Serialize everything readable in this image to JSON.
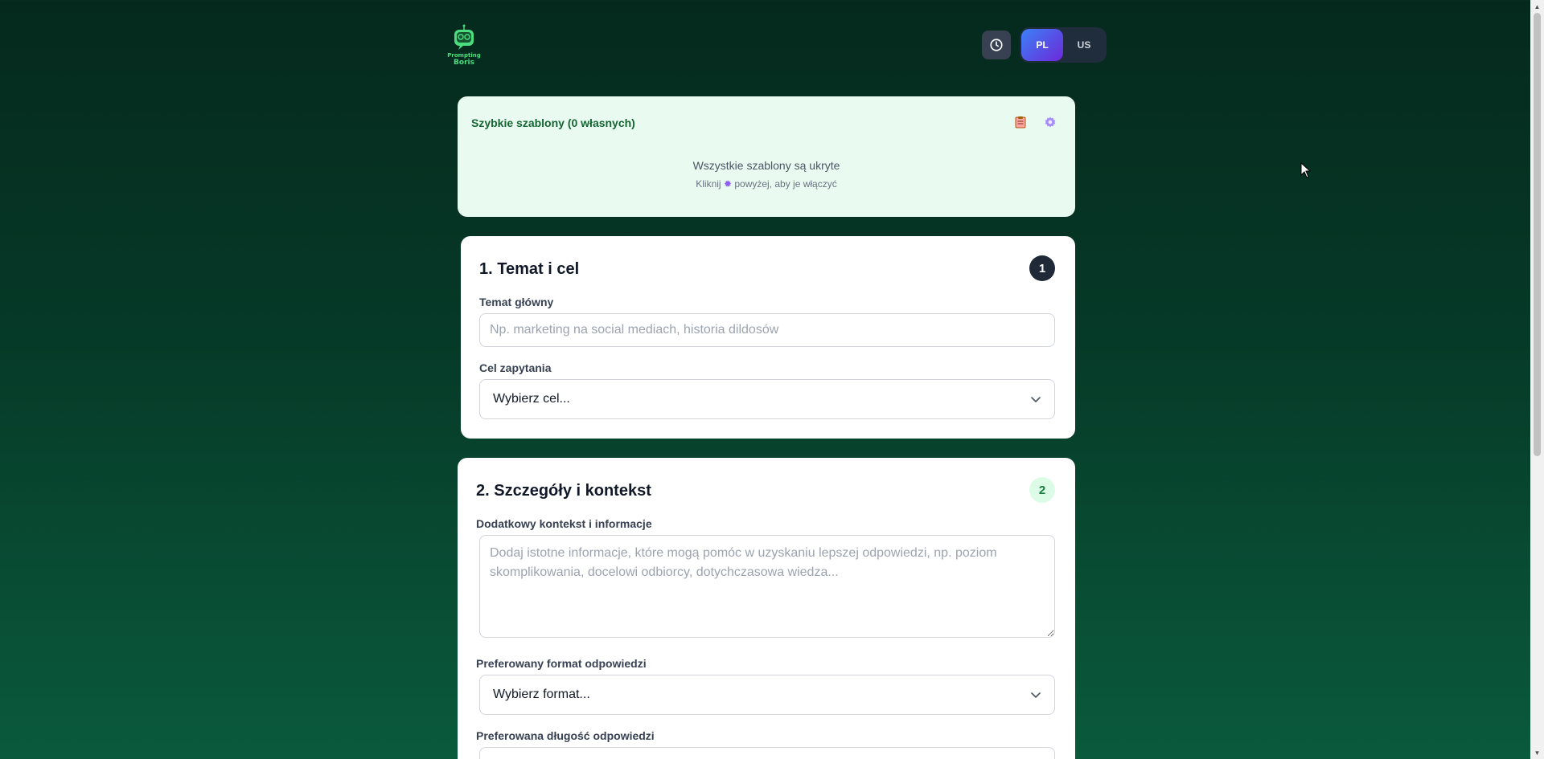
{
  "header": {
    "logo_text_line1": "Prompting",
    "logo_text_line2": "Boris",
    "history_icon": "clock-icon",
    "languages": [
      {
        "label": "PL",
        "active": true
      },
      {
        "label": "US",
        "active": false
      }
    ]
  },
  "templates": {
    "title": "Szybkie szablony (0 własnych)",
    "icons": [
      "clipboard-icon",
      "gear-icon"
    ],
    "empty_message": "Wszystkie szablony są ukryte",
    "hint_before": "Kliknij",
    "hint_after": "powyżej, aby je włączyć"
  },
  "section1": {
    "title": "1. Temat i cel",
    "badge": "1",
    "topic_label": "Temat główny",
    "topic_value": "",
    "topic_placeholder": "Np. marketing na social mediach, historia dildosów",
    "goal_label": "Cel zapytania",
    "goal_value": "Wybierz cel..."
  },
  "section2": {
    "title": "2. Szczegóły i kontekst",
    "badge": "2",
    "context_label": "Dodatkowy kontekst i informacje",
    "context_value": "",
    "context_placeholder": "Dodaj istotne informacje, które mogą pomóc w uzyskaniu lepszej odpowiedzi, np. poziom skomplikowania, docelowi odbiorcy, dotychczasowa wiedza...",
    "format_label": "Preferowany format odpowiedzi",
    "format_value": "Wybierz format...",
    "length_label": "Preferowana długość odpowiedzi"
  },
  "colors": {
    "background_top": "#05291d",
    "background_bottom": "#0a5a3d",
    "templates_bg": "#e9fbf0",
    "accent_green": "#166534",
    "lang_active_from": "#3b82f6",
    "lang_active_to": "#6d28d9"
  }
}
